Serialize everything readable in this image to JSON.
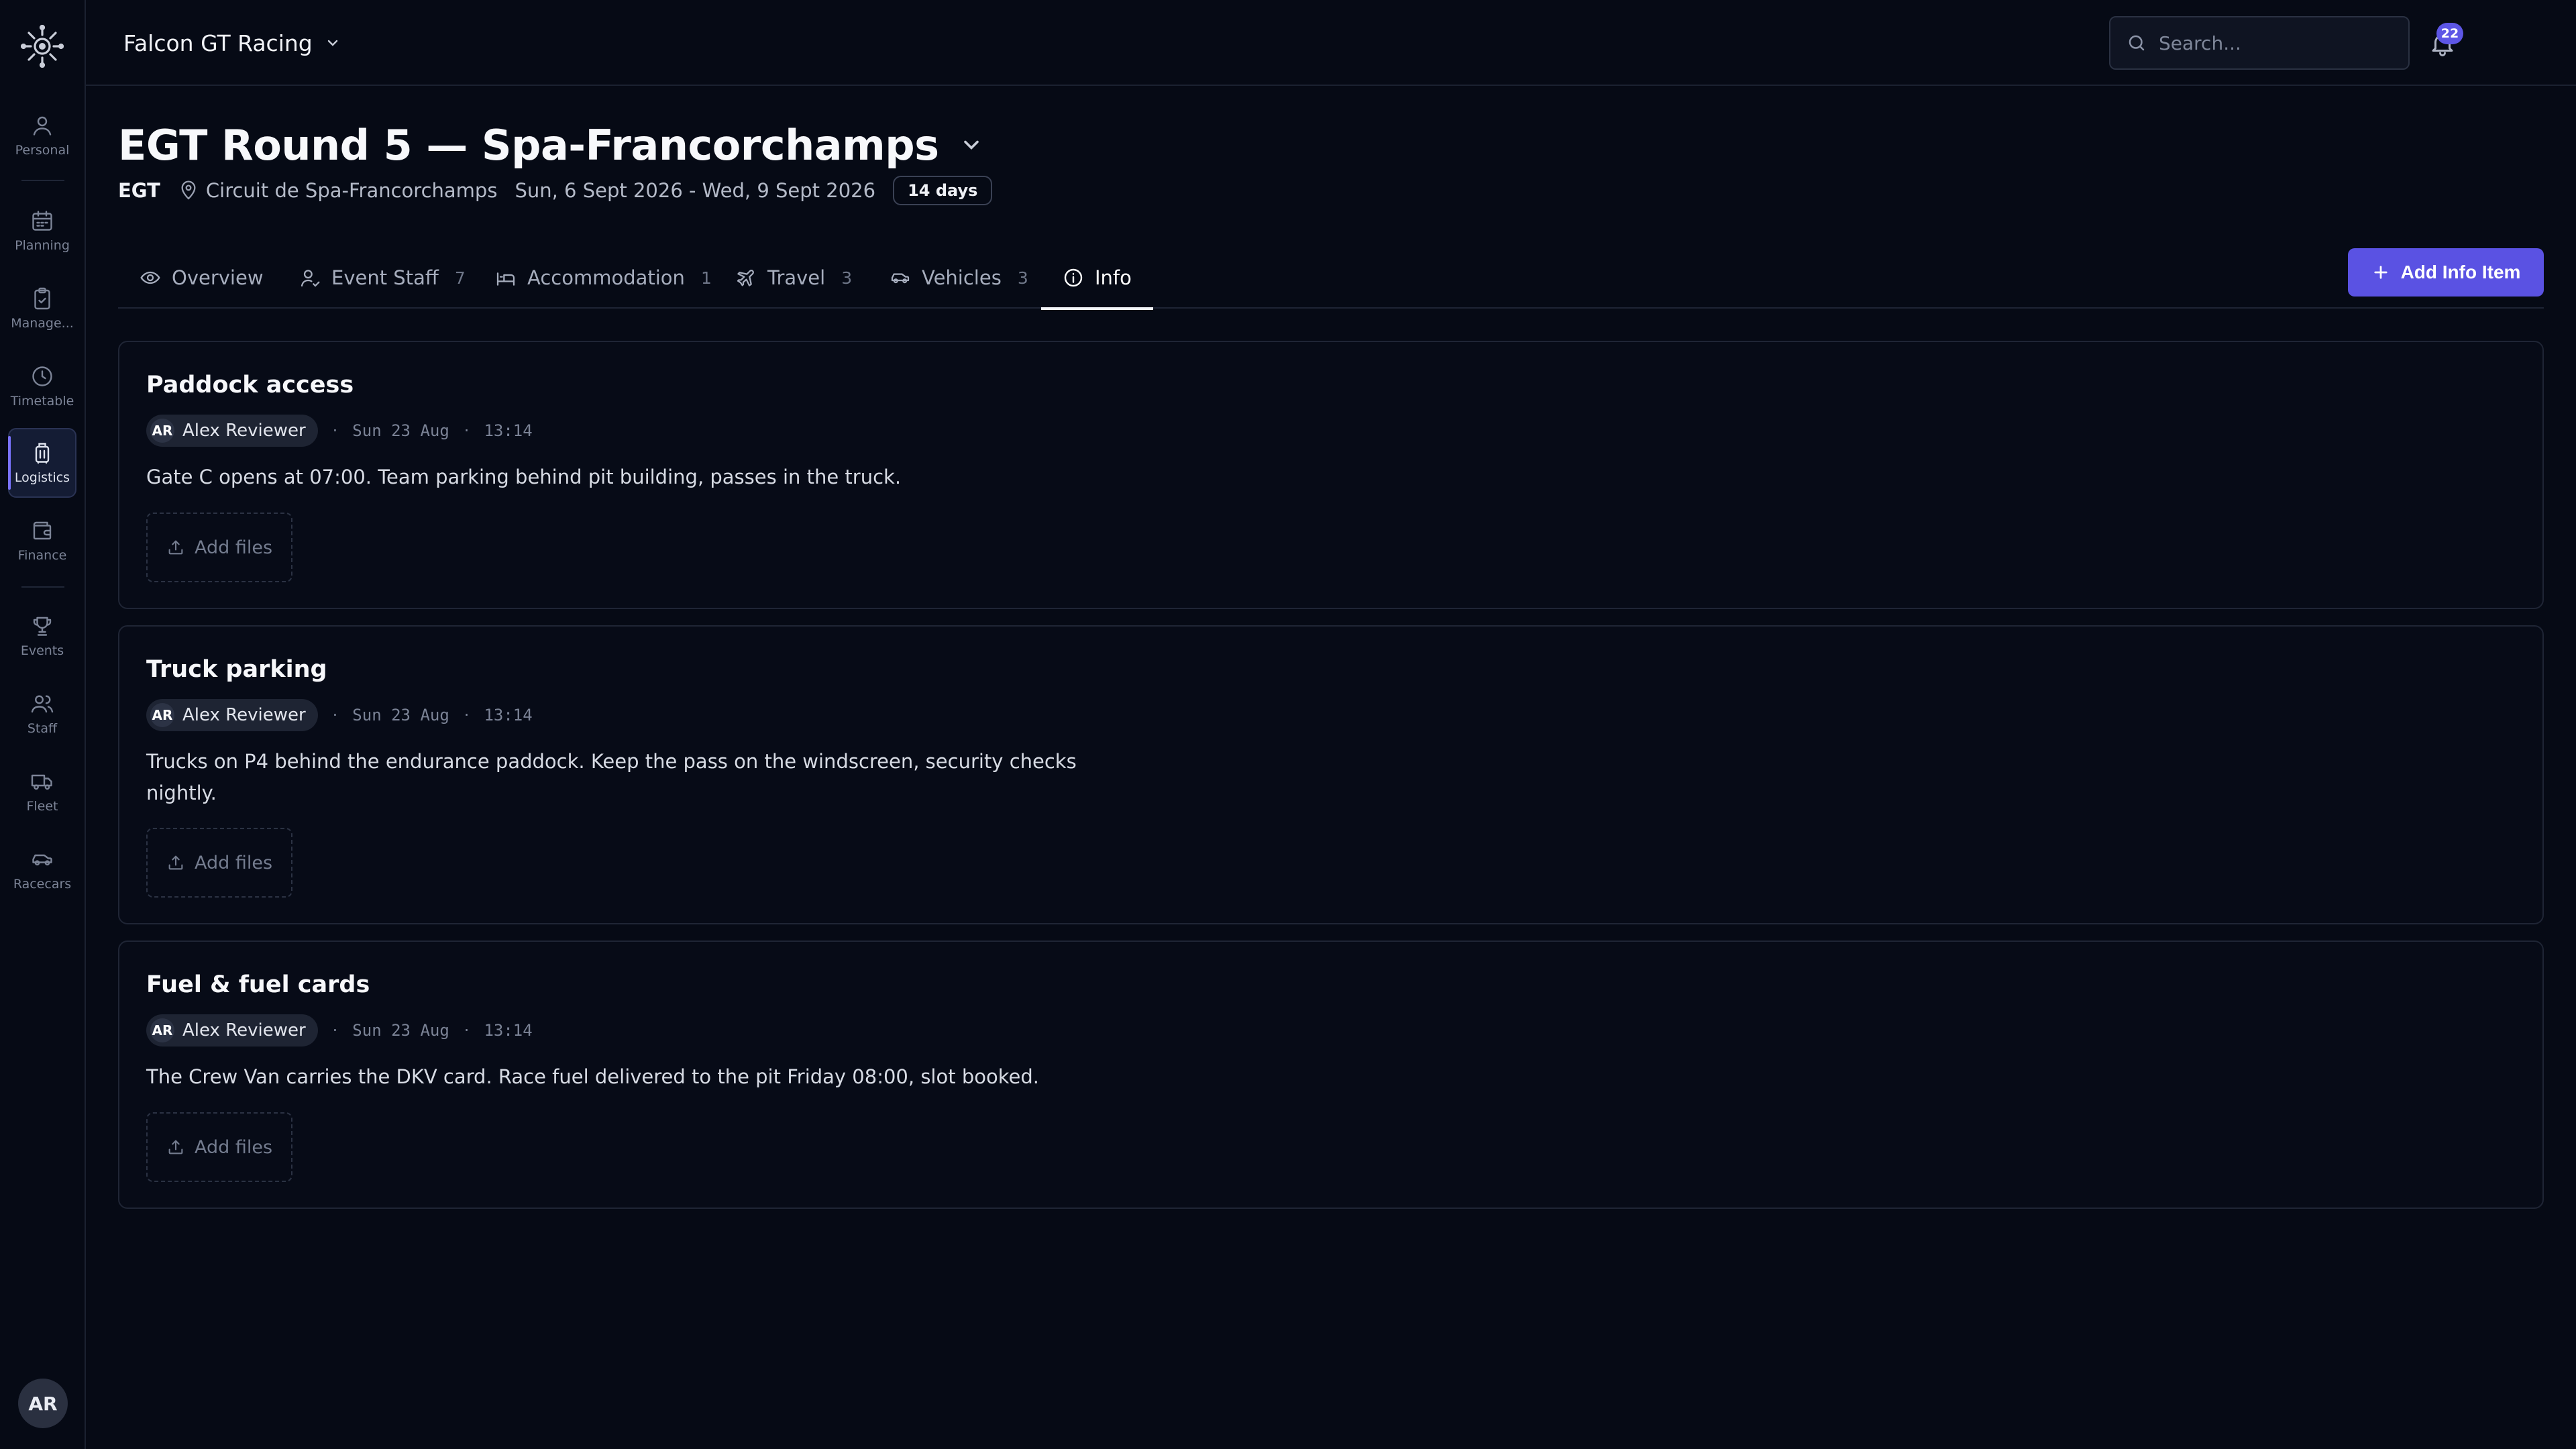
{
  "nav": {
    "items": [
      {
        "label": "Personal",
        "icon": "user-icon"
      },
      {
        "label": "Planning",
        "icon": "calendar-icon"
      },
      {
        "label": "Manage...",
        "icon": "clipboard-icon"
      },
      {
        "label": "Timetable",
        "icon": "clock-icon"
      },
      {
        "label": "Logistics",
        "icon": "luggage-icon"
      },
      {
        "label": "Finance",
        "icon": "wallet-icon"
      },
      {
        "label": "Events",
        "icon": "trophy-icon"
      },
      {
        "label": "Staff",
        "icon": "users-icon"
      },
      {
        "label": "Fleet",
        "icon": "truck-icon"
      },
      {
        "label": "Racecars",
        "icon": "car-icon"
      }
    ],
    "active": "Logistics",
    "user_initials": "AR"
  },
  "topbar": {
    "team": "Falcon GT Racing",
    "search_placeholder": "Search...",
    "notification_count": "22"
  },
  "event": {
    "title": "EGT Round 5 — Spa-Francorchamps",
    "series": "EGT",
    "location": "Circuit de Spa-Francorchamps",
    "dates": "Sun, 6 Sept 2026 - Wed, 9 Sept 2026",
    "duration": "14 days"
  },
  "tabs": [
    {
      "label": "Overview",
      "count": "",
      "icon": "eye-icon"
    },
    {
      "label": "Event Staff",
      "count": "7",
      "icon": "user-check-icon"
    },
    {
      "label": "Accommodation",
      "count": "1",
      "icon": "bed-icon"
    },
    {
      "label": "Travel",
      "count": "3",
      "icon": "plane-icon"
    },
    {
      "label": "Vehicles",
      "count": "3",
      "icon": "car-icon"
    },
    {
      "label": "Info",
      "count": "",
      "icon": "info-icon"
    }
  ],
  "active_tab": "Info",
  "add_button_label": "Add Info Item",
  "info_items": [
    {
      "title": "Paddock access",
      "author_initials": "AR",
      "author": "Alex Reviewer",
      "date": "Sun 23 Aug",
      "time": "13:14",
      "body": "Gate C opens at 07:00. Team parking behind pit building, passes in the truck.",
      "add_files_label": "Add files"
    },
    {
      "title": "Truck parking",
      "author_initials": "AR",
      "author": "Alex Reviewer",
      "date": "Sun 23 Aug",
      "time": "13:14",
      "body": "Trucks on P4 behind the endurance paddock. Keep the pass on the windscreen, security checks nightly.",
      "add_files_label": "Add files"
    },
    {
      "title": "Fuel & fuel cards",
      "author_initials": "AR",
      "author": "Alex Reviewer",
      "date": "Sun 23 Aug",
      "time": "13:14",
      "body": "The Crew Van carries the DKV card. Race fuel delivered to the pit Friday 08:00, slot booked.",
      "add_files_label": "Add files"
    }
  ],
  "colors": {
    "background": "#060a15",
    "accent": "#5a52e3",
    "border": "#1f2535"
  }
}
